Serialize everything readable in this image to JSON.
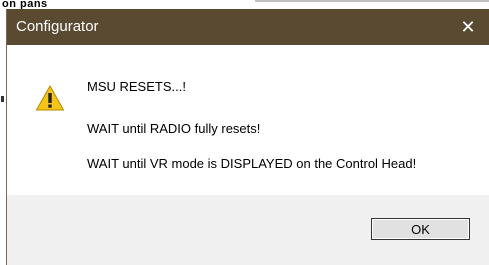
{
  "background": {
    "fragment_text": "on pans"
  },
  "dialog": {
    "title": "Configurator",
    "close_glyph": "✕",
    "icon": "warning-icon",
    "messages": [
      "MSU RESETS...!",
      "WAIT until RADIO fully resets!",
      "WAIT until VR mode is DISPLAYED on the Control Head!"
    ],
    "ok_label": "OK"
  },
  "colors": {
    "titlebar": "#5a4a32",
    "footer": "#f0f0f0",
    "warning_fill": "#f5c518"
  }
}
